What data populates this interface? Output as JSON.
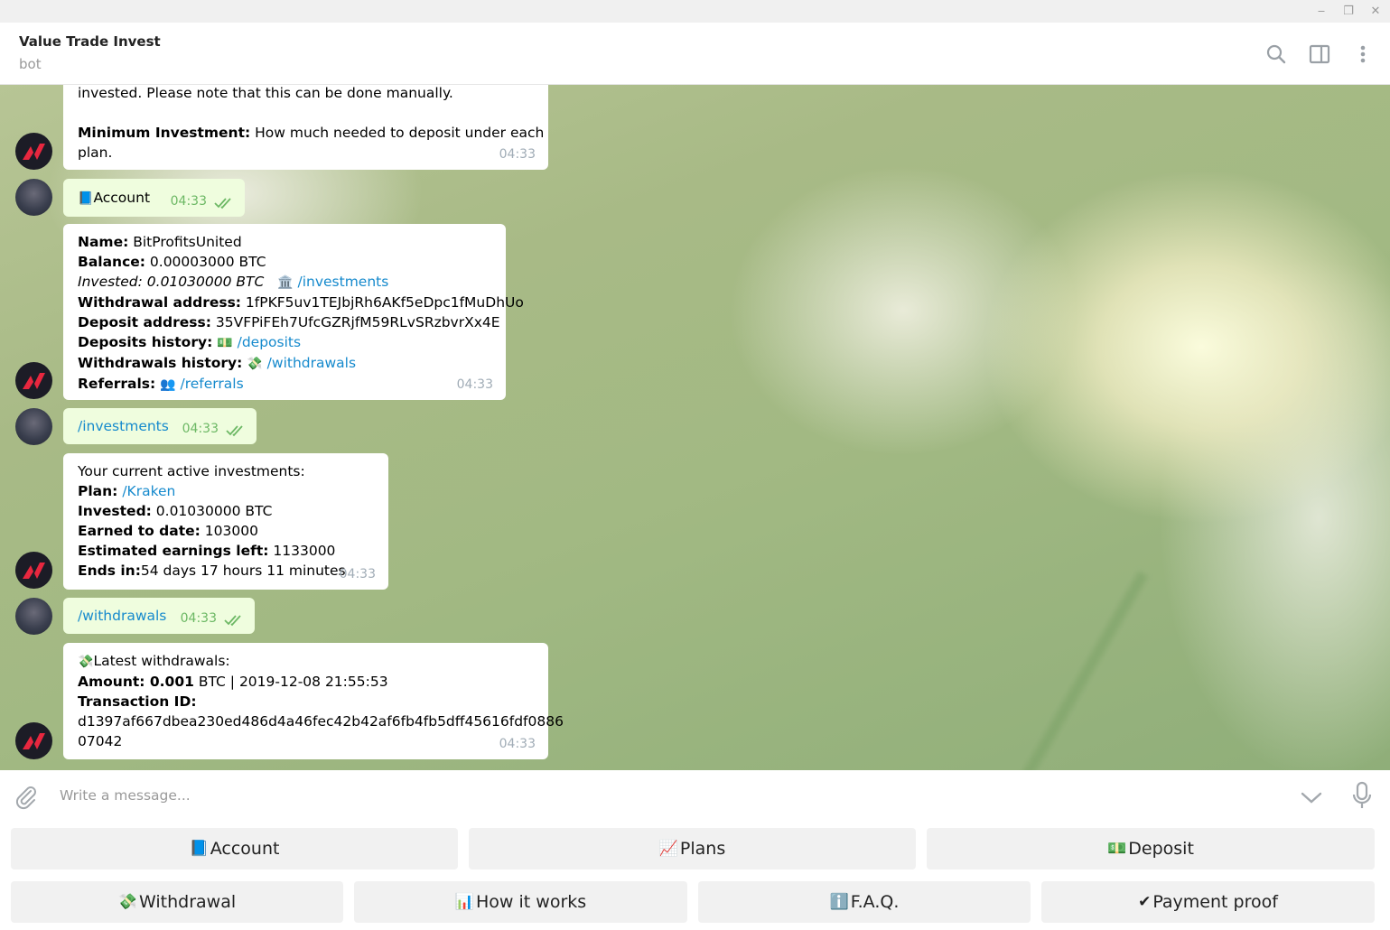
{
  "window": {
    "minimize": "‒",
    "maximize": "❐",
    "close": "✕"
  },
  "header": {
    "title": "Value Trade Invest",
    "status": "bot"
  },
  "messages": {
    "m1": {
      "line1": "invested. Please note that this can be done manually.",
      "min_label": "Minimum Investment:",
      "min_text": " How much needed to deposit under each",
      "min_text2": "plan.",
      "time": "04:33"
    },
    "m2": {
      "emoji": "📘",
      "text": "Account",
      "time": "04:33"
    },
    "m3": {
      "name_label": "Name:",
      "name": " BitProfitsUnited",
      "balance_label": "Balance:",
      "balance": " 0.00003000 BTC",
      "invested": "Invested: 0.01030000 BTC",
      "invested_emoji": "🏛️",
      "invested_link": "/investments",
      "wd_addr_label": "Withdrawal address:",
      "wd_addr": " 1fPKF5uv1TEJbjRh6AKf5eDpc1fMuDhUo",
      "dep_addr_label": "Deposit address:",
      "dep_addr": " 35VFPiFEh7UfcGZRjfM59RLvSRzbvrXx4E",
      "dep_hist_label": "Deposits history:",
      "dep_emoji": "💵",
      "dep_link": "/deposits",
      "wd_hist_label": "Withdrawals history:",
      "wd_emoji": "💸",
      "wd_link": "/withdrawals",
      "ref_label": "Referrals:",
      "ref_emoji": "👥",
      "ref_link": "/referrals",
      "time": "04:33"
    },
    "m4": {
      "text": "/investments",
      "time": "04:33"
    },
    "m5": {
      "intro": "Your current active investments:",
      "plan_label": "Plan:",
      "plan_link": "/Kraken",
      "invested_label": "Invested:",
      "invested": " 0.01030000 BTC",
      "earned_label": "Earned to date:",
      "earned": " 103000",
      "left_label": "Estimated earnings left:",
      "left": " 1133000",
      "ends_label": "Ends in:",
      "ends": "54 days 17 hours 11 minutes",
      "time": "04:33"
    },
    "m6": {
      "text": "/withdrawals",
      "time": "04:33"
    },
    "m7": {
      "emoji": "💸",
      "title": "Latest withdrawals:",
      "amount_label": "Amount:",
      "amount": " 0.001",
      "amount_rest": " BTC | 2019-12-08 21:55:53",
      "txid_label": "Transaction ID:",
      "txid1": "d1397af667dbea230ed486d4a46fec42b42af6fb4fb5dff45616fdf0886",
      "txid2": "07042",
      "time": "04:33"
    }
  },
  "composer": {
    "placeholder": "Write a message..."
  },
  "keyboard": {
    "row1": [
      {
        "icon": "📘",
        "label": "Account"
      },
      {
        "icon": "📈",
        "label": "Plans"
      },
      {
        "icon": "💵",
        "label": "Deposit"
      }
    ],
    "row2": [
      {
        "icon": "💸",
        "label": "Withdrawal"
      },
      {
        "icon": "📊",
        "label": "How it works"
      },
      {
        "icon": "ℹ️",
        "label": "F.A.Q."
      },
      {
        "icon": "✔",
        "label": "Payment proof"
      }
    ]
  },
  "icons": {
    "search": "search-icon",
    "panel": "sidebar-toggle-icon",
    "more": "more-vertical-icon",
    "attach": "paperclip-icon",
    "chevron": "chevron-down-icon",
    "mic": "microphone-icon",
    "ticks": "double-check-icon"
  },
  "colors": {
    "link": "#168acd",
    "outgoing": "#effdde",
    "time_out": "#6cb864",
    "time_in": "#a0acb6"
  }
}
